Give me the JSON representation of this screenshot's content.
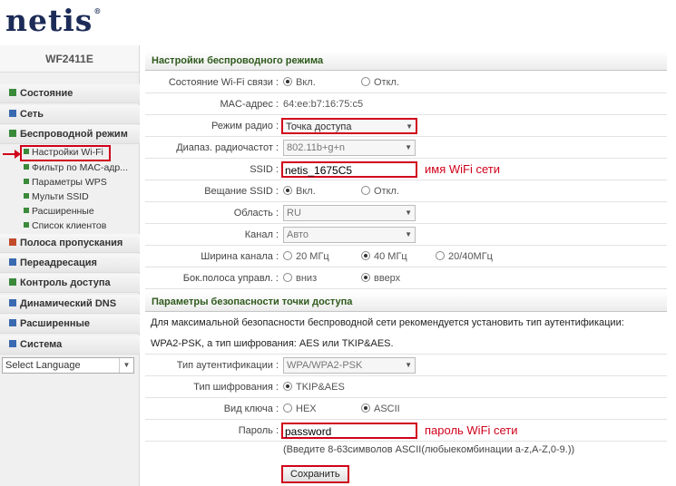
{
  "brand": {
    "logo": "netis",
    "reg": "®"
  },
  "sidebar": {
    "model": "WF2411E",
    "items": [
      {
        "label": "Состояние",
        "color": "#3a8a3a"
      },
      {
        "label": "Сеть",
        "color": "#3a6ab0"
      },
      {
        "label": "Беспроводной режим",
        "color": "#3a8a3a"
      },
      {
        "label": "Полоса пропускания",
        "color": "#c24a2a"
      },
      {
        "label": "Переадресация",
        "color": "#3a6ab0"
      },
      {
        "label": "Контроль доступа",
        "color": "#3a8a3a"
      },
      {
        "label": "Динамический DNS",
        "color": "#3a6ab0"
      },
      {
        "label": "Расширенные",
        "color": "#3a6ab0"
      },
      {
        "label": "Система",
        "color": "#3a6ab0"
      }
    ],
    "subitems": [
      "Настройки Wi-Fi",
      "Фильтр по MAC-адр...",
      "Параметры WPS",
      "Мульти SSID",
      "Расширенные",
      "Список клиентов"
    ],
    "language": "Select Language"
  },
  "wireless": {
    "title": "Настройки беспроводного режима",
    "status": {
      "label": "Состояние Wi-Fi связи :",
      "on": "Вкл.",
      "off": "Откл."
    },
    "mac": {
      "label": "MAC-адрес :",
      "value": "64:ee:b7:16:75:c5"
    },
    "mode": {
      "label": "Режим радио :",
      "value": "Точка доступа"
    },
    "band": {
      "label": "Диапаз. радиочастот :",
      "value": "802.11b+g+n"
    },
    "ssid": {
      "label": "SSID :",
      "value": "netis_1675C5",
      "note": "имя WiFi сети"
    },
    "broadcast": {
      "label": "Вещание SSID :",
      "on": "Вкл.",
      "off": "Откл."
    },
    "region": {
      "label": "Область :",
      "value": "RU"
    },
    "channel": {
      "label": "Канал :",
      "value": "Авто"
    },
    "width": {
      "label": "Ширина канала :",
      "o1": "20 МГц",
      "o2": "40 МГц",
      "o3": "20/40МГц"
    },
    "sideband": {
      "label": "Бок.полоса управл. :",
      "o1": "вниз",
      "o2": "вверх"
    }
  },
  "security": {
    "title": "Параметры безопасности точки доступа",
    "notice1": "Для максимальной безопасности беспроводной сети рекомендуется установить тип аутентификации:",
    "notice2": "WPA2-PSK, а тип шифрования: AES или TKIP&AES.",
    "auth": {
      "label": "Тип аутентификации :",
      "value": "WPA/WPA2-PSK"
    },
    "cipher": {
      "label": "Тип шифрования :",
      "value": "TKIP&AES"
    },
    "keytype": {
      "label": "Вид ключа :",
      "o1": "HEX",
      "o2": "ASCII"
    },
    "password": {
      "label": "Пароль :",
      "value": "password",
      "note": "пароль WiFi сети"
    },
    "hint": "(Введите 8-63символов ASCII(любыекомбинации a-z,A-Z,0-9.))",
    "save": "Сохранить"
  },
  "colors": {
    "accent_red": "#d0021b",
    "section_green": "#2e5a1c",
    "logo_navy": "#1c2b57"
  }
}
